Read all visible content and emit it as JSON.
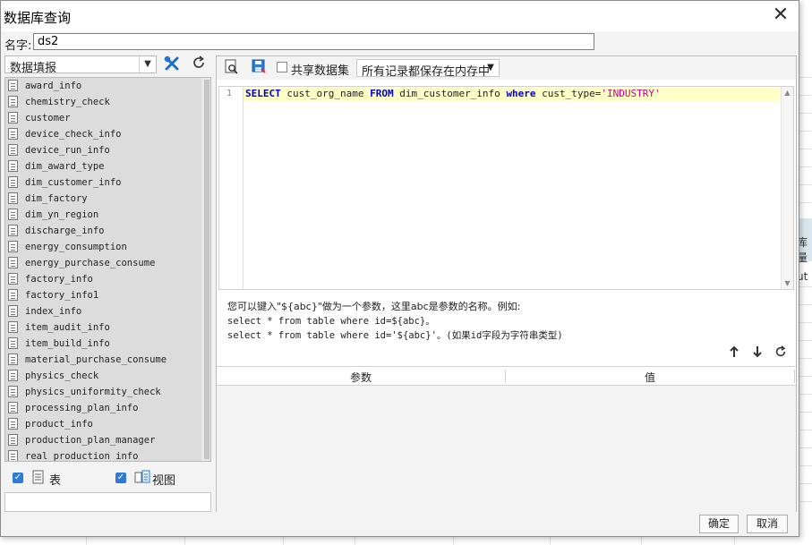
{
  "dialog": {
    "title": "数据库查询",
    "close_glyph": "✕",
    "name_label": "名字:",
    "name_value": "ds2",
    "ok_label": "确定",
    "cancel_label": "取消"
  },
  "left": {
    "connection": "数据填报",
    "tables": [
      "award_info",
      "chemistry_check",
      "customer",
      "device_check_info",
      "device_run_info",
      "dim_award_type",
      "dim_customer_info",
      "dim_factory",
      "dim_yn_region",
      "discharge_info",
      "energy_consumption",
      "energy_purchase_consume",
      "factory_info",
      "factory_info1",
      "index_info",
      "item_audit_info",
      "item_build_info",
      "material_purchase_consume",
      "physics_check",
      "physics_uniformity_check",
      "processing_plan_info",
      "product_info",
      "production_plan_manager",
      "real_production_info"
    ],
    "filter_table_label": "表",
    "filter_view_label": "视图",
    "filter_table_checked": true,
    "filter_view_checked": true
  },
  "right": {
    "share_label": "共享数据集",
    "share_checked": false,
    "mode_value": "所有记录都保存在内存中",
    "line_number": "1",
    "sql": {
      "kw1": "SELECT",
      "t1": " cust_org_name ",
      "kw2": "FROM",
      "t2": " dim_customer_info ",
      "kw3": "where",
      "t3": " cust_type=",
      "str": "'INDUSTRY'"
    },
    "hint_line1": "您可以键入\"${abc}\"做为一个参数，这里abc是参数的名称。例如:",
    "hint_line2": "select * from table where id=${abc}。",
    "hint_line3": "select * from table where id='${abc}'。(如果id字段为字符串类型)",
    "param_col1": "参数",
    "param_col2": "值"
  },
  "background": {
    "peek_text1": "库量",
    "peek_text2": "ut"
  },
  "colors": {
    "accent": "#2e7bd6",
    "keyword": "#0000cc",
    "string": "#cc0088",
    "highlight_line": "#ffffc8"
  }
}
